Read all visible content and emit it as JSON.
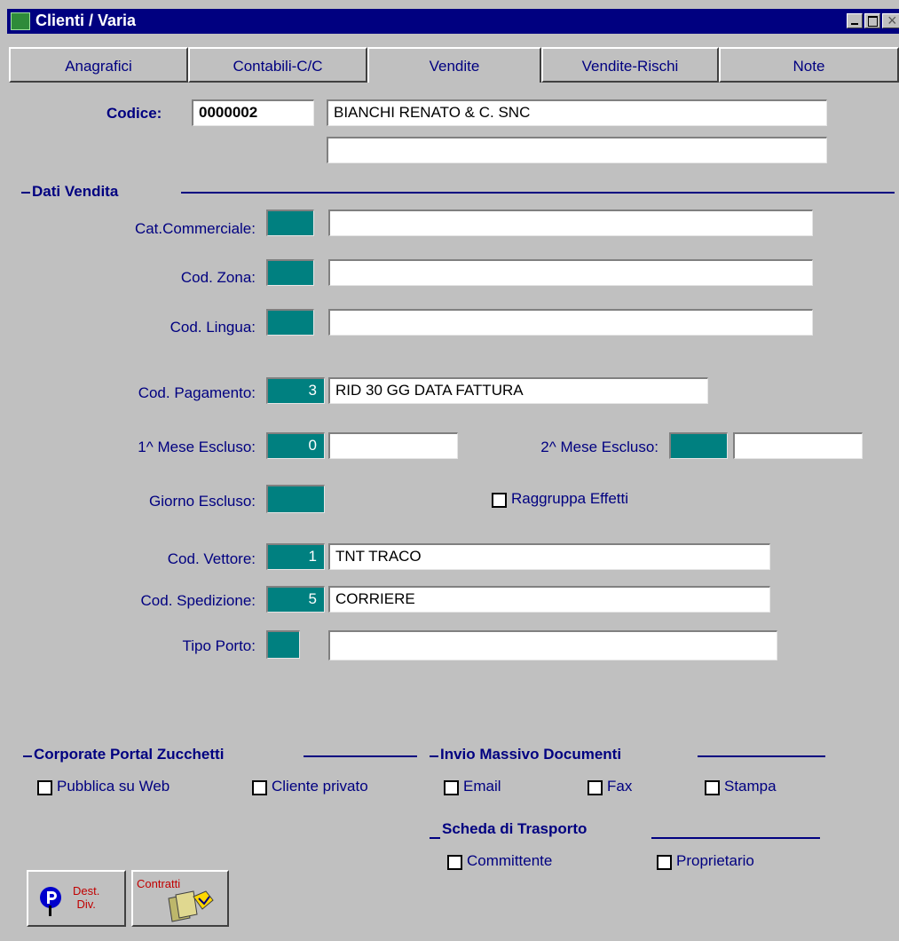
{
  "window": {
    "title": "Clienti / Varia"
  },
  "tabs": [
    {
      "label": "Anagrafici"
    },
    {
      "label": "Contabili-C/C"
    },
    {
      "label": "Vendite"
    },
    {
      "label": "Vendite-Rischi"
    },
    {
      "label": "Note"
    }
  ],
  "header": {
    "codice_label": "Codice:",
    "codice_value": "0000002",
    "ragione_sociale": "BIANCHI RENATO & C. SNC",
    "ragione_sociale_2": ""
  },
  "dati_vendita": {
    "section_title": "Dati Vendita",
    "cat_commerciale": {
      "label": "Cat.Commerciale:",
      "code": "",
      "desc": ""
    },
    "cod_zona": {
      "label": "Cod. Zona:",
      "code": "",
      "desc": ""
    },
    "cod_lingua": {
      "label": "Cod. Lingua:",
      "code": "",
      "desc": ""
    },
    "cod_pagamento": {
      "label": "Cod. Pagamento:",
      "code": "3",
      "desc": "RID 30 GG DATA FATTURA"
    },
    "mese_escluso_1": {
      "label": "1^ Mese Escluso:",
      "code": "0",
      "desc": ""
    },
    "mese_escluso_2": {
      "label": "2^ Mese Escluso:",
      "code": "",
      "desc": ""
    },
    "giorno_escluso": {
      "label": "Giorno Escluso:",
      "code": ""
    },
    "raggruppa_effetti": {
      "label": "Raggruppa Effetti",
      "checked": false
    },
    "cod_vettore": {
      "label": "Cod. Vettore:",
      "code": "1",
      "desc": "TNT TRACO"
    },
    "cod_spedizione": {
      "label": "Cod. Spedizione:",
      "code": "5",
      "desc": "CORRIERE"
    },
    "tipo_porto": {
      "label": "Tipo Porto:",
      "code": "",
      "desc": ""
    }
  },
  "corporate_portal": {
    "section_title": "Corporate Portal Zucchetti",
    "pubblica_web": {
      "label": "Pubblica su Web",
      "checked": false
    },
    "cliente_privato": {
      "label": "Cliente privato",
      "checked": false
    }
  },
  "invio_massivo": {
    "section_title": "Invio Massivo Documenti",
    "email": {
      "label": "Email",
      "checked": false
    },
    "fax": {
      "label": "Fax",
      "checked": false
    },
    "stampa": {
      "label": "Stampa",
      "checked": false
    }
  },
  "scheda_trasporto": {
    "section_title": "Scheda di Trasporto",
    "committente": {
      "label": "Committente",
      "checked": false
    },
    "proprietario": {
      "label": "Proprietario",
      "checked": false
    }
  },
  "buttons": {
    "dest_div": {
      "label_line1": "Dest.",
      "label_line2": "Div."
    },
    "contratti": {
      "label": "Contratti"
    }
  },
  "colors": {
    "label": "#000080",
    "code_field": "#008080",
    "background": "#c0c0c0",
    "titlebar": "#000080"
  }
}
